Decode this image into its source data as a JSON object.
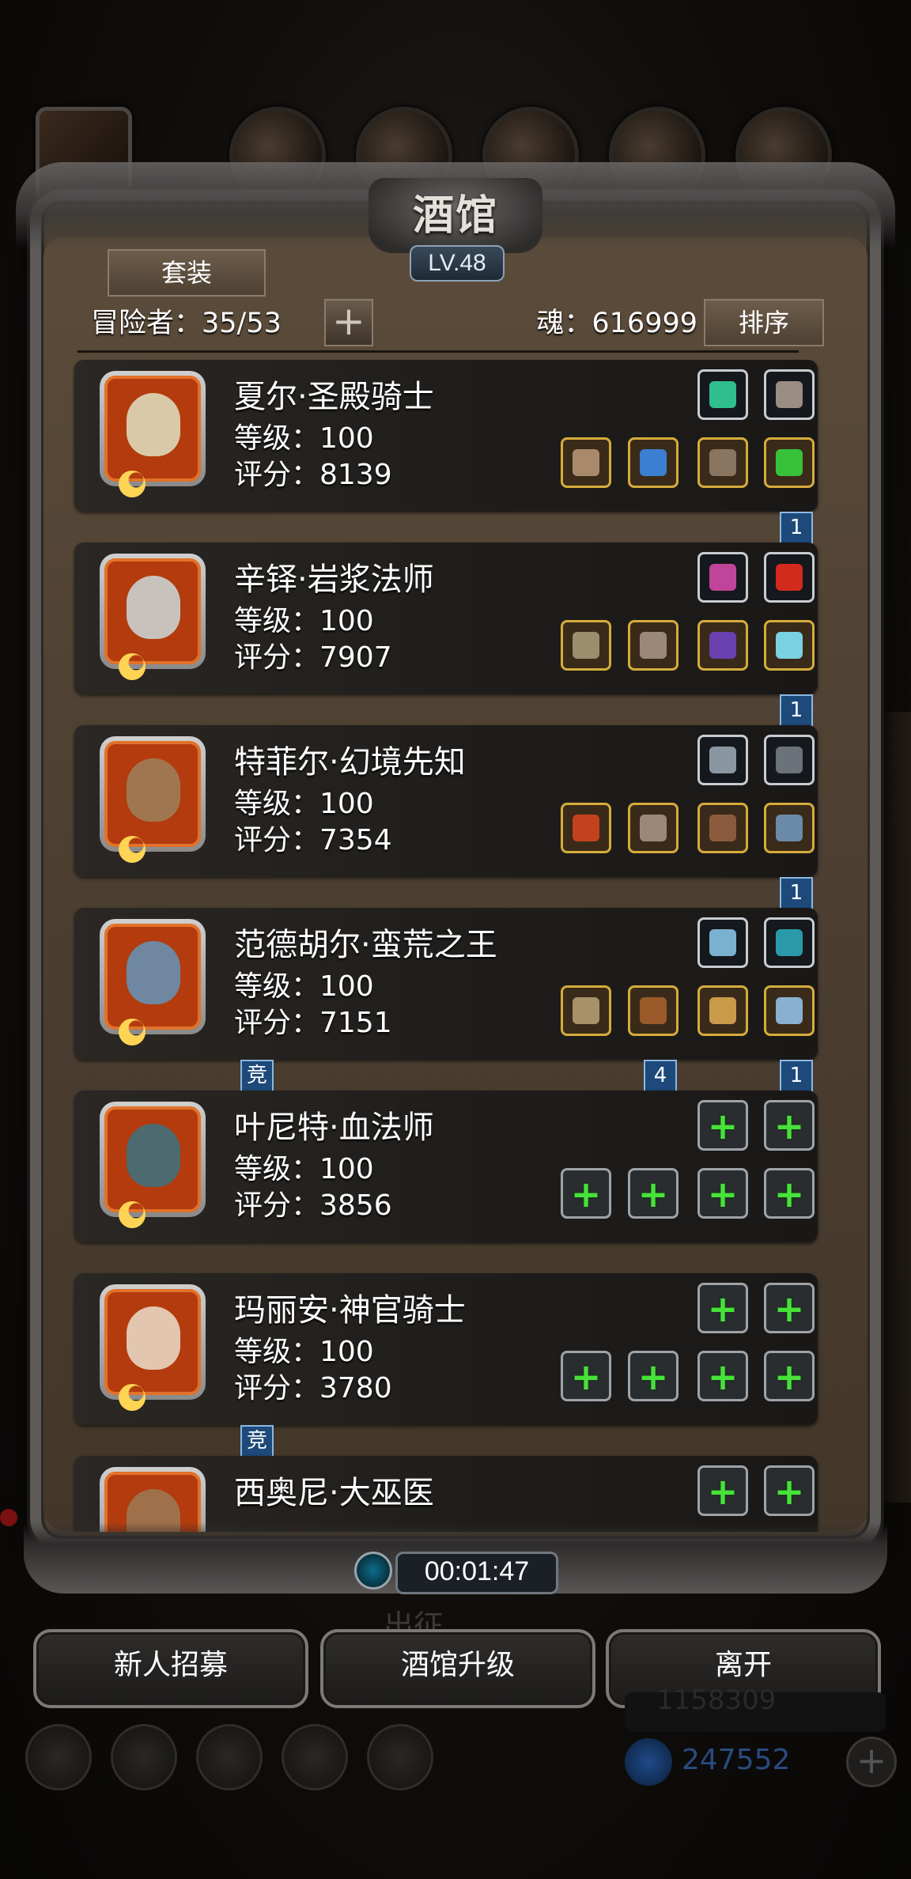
{
  "tavern": {
    "title": "酒馆",
    "level": "LV.48",
    "tab_suit": "套装",
    "adventurers_label": "冒险者：35/53",
    "add_symbol": "+",
    "soul_label": "魂：616999",
    "sort_label": "排序"
  },
  "heroes": [
    {
      "name": "夏尔·圣殿骑士",
      "level": "等级：100",
      "score": "评分：8139",
      "portrait_color": "#d9c9a8",
      "slots_top": [
        {
          "kind": "dark",
          "icon": "green-gem-icon",
          "color": "#2fbf8f"
        },
        {
          "kind": "dark",
          "icon": "feather-icon",
          "color": "#9a8d82"
        }
      ],
      "slots_bottom": [
        {
          "kind": "gold",
          "icon": "staff-icon",
          "color": "#a88a6a"
        },
        {
          "kind": "gold",
          "icon": "armor-icon",
          "color": "#3a7fd0"
        },
        {
          "kind": "gold",
          "icon": "mask-icon",
          "color": "#8a7560"
        },
        {
          "kind": "gold",
          "icon": "emerald-icon",
          "color": "#38c23a"
        }
      ],
      "ribbons": [
        {
          "text": "1",
          "pos": "right"
        }
      ]
    },
    {
      "name": "辛铎·岩浆法师",
      "level": "等级：100",
      "score": "评分：7907",
      "portrait_color": "#c8c2bc",
      "slots_top": [
        {
          "kind": "dark",
          "icon": "coral-icon",
          "color": "#c0459a"
        },
        {
          "kind": "dark",
          "icon": "red-gem-icon",
          "color": "#d22a1c"
        }
      ],
      "slots_bottom": [
        {
          "kind": "gold",
          "icon": "wand-icon",
          "color": "#9b8d6e"
        },
        {
          "kind": "gold",
          "icon": "armor-icon",
          "color": "#9b8878"
        },
        {
          "kind": "gold",
          "icon": "purple-ring-icon",
          "color": "#6a3fb0"
        },
        {
          "kind": "gold",
          "icon": "blue-orb-icon",
          "color": "#7ad2e0"
        }
      ],
      "ribbons": [
        {
          "text": "1",
          "pos": "right"
        }
      ]
    },
    {
      "name": "特菲尔·幻境先知",
      "level": "等级：100",
      "score": "评分：7354",
      "portrait_color": "#a07650",
      "slots_top": [
        {
          "kind": "dark",
          "icon": "emblem-icon",
          "color": "#8b96a3"
        },
        {
          "kind": "dark",
          "icon": "mask-icon",
          "color": "#6b7279"
        }
      ],
      "slots_bottom": [
        {
          "kind": "gold",
          "icon": "mace-icon",
          "color": "#c2421e"
        },
        {
          "kind": "gold",
          "icon": "armor-icon",
          "color": "#9b8878"
        },
        {
          "kind": "gold",
          "icon": "bracer-icon",
          "color": "#8b5a3c"
        },
        {
          "kind": "gold",
          "icon": "ring-icon",
          "color": "#6a8aa8"
        }
      ],
      "ribbons": [
        {
          "text": "1",
          "pos": "right"
        }
      ]
    },
    {
      "name": "范德胡尔·蛮荒之王",
      "level": "等级：100",
      "score": "评分：7151",
      "portrait_color": "#6f87a0",
      "slots_top": [
        {
          "kind": "dark",
          "icon": "necklace-icon",
          "color": "#7ab0d0"
        },
        {
          "kind": "dark",
          "icon": "teal-gem-icon",
          "color": "#2a9aa8"
        }
      ],
      "slots_bottom": [
        {
          "kind": "gold",
          "icon": "axe-icon",
          "color": "#a89068"
        },
        {
          "kind": "gold",
          "icon": "armor-icon",
          "color": "#9a5a2a"
        },
        {
          "kind": "gold",
          "icon": "horn-icon",
          "color": "#c89a4a"
        },
        {
          "kind": "gold",
          "icon": "ring-icon",
          "color": "#8ab0d0"
        }
      ],
      "ribbons": [
        {
          "text": "竞",
          "pos": "left"
        },
        {
          "text": "4",
          "pos": "mid"
        },
        {
          "text": "1",
          "pos": "right"
        }
      ]
    },
    {
      "name": "叶尼特·血法师",
      "level": "等级：100",
      "score": "评分：3856",
      "portrait_color": "#4c6a70",
      "slots_top": [
        {
          "kind": "empty",
          "icon": "plus-icon"
        },
        {
          "kind": "empty",
          "icon": "plus-icon"
        }
      ],
      "slots_bottom": [
        {
          "kind": "empty",
          "icon": "plus-icon"
        },
        {
          "kind": "empty",
          "icon": "plus-icon"
        },
        {
          "kind": "empty",
          "icon": "plus-icon"
        },
        {
          "kind": "empty",
          "icon": "plus-icon"
        }
      ],
      "ribbons": []
    },
    {
      "name": "玛丽安·神官骑士",
      "level": "等级：100",
      "score": "评分：3780",
      "portrait_color": "#e2c6b0",
      "slots_top": [
        {
          "kind": "empty",
          "icon": "plus-icon"
        },
        {
          "kind": "empty",
          "icon": "plus-icon"
        }
      ],
      "slots_bottom": [
        {
          "kind": "empty",
          "icon": "plus-icon"
        },
        {
          "kind": "empty",
          "icon": "plus-icon"
        },
        {
          "kind": "empty",
          "icon": "plus-icon"
        },
        {
          "kind": "empty",
          "icon": "plus-icon"
        }
      ],
      "ribbons": [
        {
          "text": "竞",
          "pos": "left"
        }
      ]
    },
    {
      "name": "西奥尼·大巫医",
      "level": "",
      "score": "",
      "portrait_color": "#a0704a",
      "slots_top": [
        {
          "kind": "empty",
          "icon": "plus-icon"
        },
        {
          "kind": "empty",
          "icon": "plus-icon"
        }
      ],
      "slots_bottom": [],
      "ribbons": []
    }
  ],
  "timer": "00:01:47",
  "behind_label": "出征",
  "actions": {
    "recruit": "新人招募",
    "upgrade": "酒馆升级",
    "leave": "离开"
  },
  "hud": {
    "gold": "1158309",
    "gems": "247552"
  }
}
